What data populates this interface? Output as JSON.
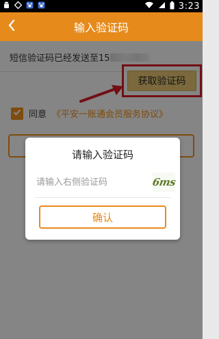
{
  "status_bar": {
    "time": "3:23",
    "left_icons": [
      "android-icon",
      "status-icon",
      "paw-icon",
      "paw-icon"
    ],
    "right_icons": [
      "wifi-icon",
      "signal-icon",
      "battery-icon"
    ]
  },
  "header": {
    "title": "输入验证码",
    "back_icon": "chevron-left-icon",
    "bg_color": "#e68a1c"
  },
  "sms": {
    "text": "短信验证码已经发送至15"
  },
  "get_code_button": {
    "label": "获取验证码"
  },
  "agreement": {
    "checked": true,
    "prefix": "同意",
    "link": "《平安一账通会员服务协议》"
  },
  "dialog": {
    "title": "请输入验证码",
    "input_placeholder": "请输入右侧验证码",
    "captcha_text": "6ms",
    "confirm_label": "确认"
  },
  "colors": {
    "accent": "#e68a1c",
    "highlight_border": "#d11d23",
    "get_code_bg": "#e1c06f"
  }
}
